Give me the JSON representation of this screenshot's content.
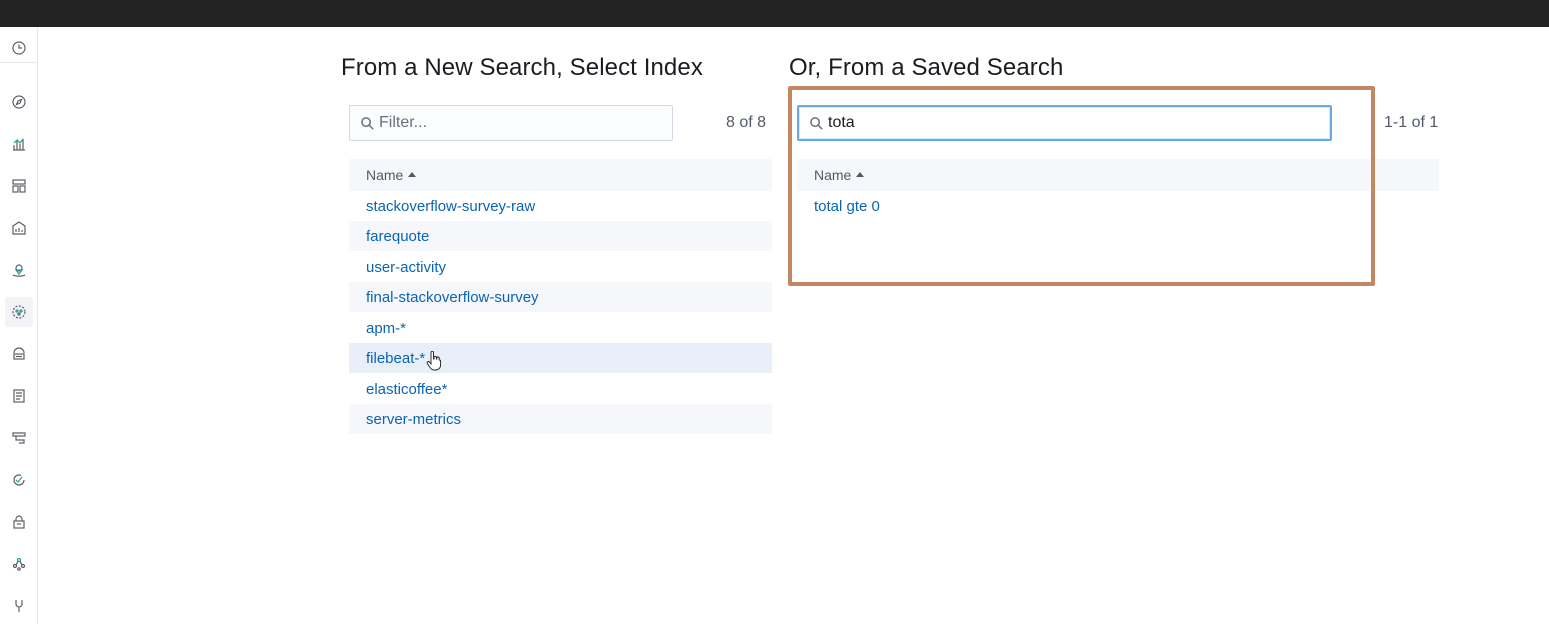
{
  "left_panel": {
    "title": "From a New Search, Select Index",
    "filter_placeholder": "Filter...",
    "count": "8 of 8",
    "column_header": "Name",
    "rows": [
      "stackoverflow-survey-raw",
      "farequote",
      "user-activity",
      "final-stackoverflow-survey",
      "apm-*",
      "filebeat-*",
      "elasticoffee*",
      "server-metrics"
    ]
  },
  "right_panel": {
    "title": "Or, From a Saved Search",
    "search_value": "tota",
    "count": "1-1 of 1",
    "column_header": "Name",
    "rows": [
      "total gte 0"
    ]
  },
  "colors": {
    "link": "#0b64b4",
    "highlight_border": "#c58662",
    "topbar": "#232323"
  },
  "sidebar_icons": [
    "clock-icon",
    "compass-icon",
    "visualize-icon",
    "dashboard-icon",
    "canvas-icon",
    "maps-icon",
    "machine-learning-icon",
    "infrastructure-icon",
    "logs-icon",
    "apm-icon",
    "uptime-icon",
    "siem-icon",
    "graph-icon",
    "dev-tools-icon"
  ]
}
